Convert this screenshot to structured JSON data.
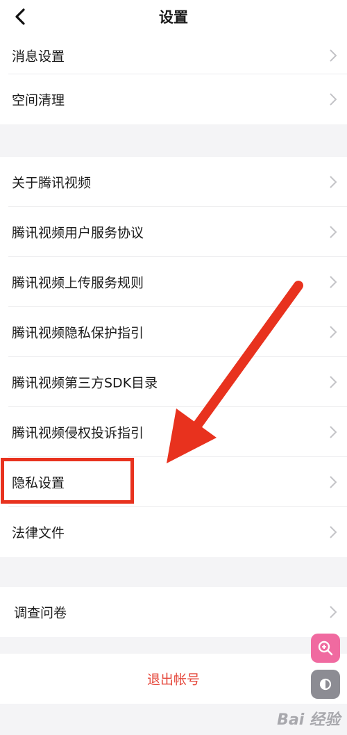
{
  "header": {
    "title": "设置"
  },
  "group1": {
    "items": [
      {
        "label": "消息设置"
      },
      {
        "label": "空间清理"
      }
    ]
  },
  "group2": {
    "items": [
      {
        "label": "关于腾讯视频"
      },
      {
        "label": "腾讯视频用户服务协议"
      },
      {
        "label": "腾讯视频上传服务规则"
      },
      {
        "label": "腾讯视频隐私保护指引"
      },
      {
        "label": "腾讯视频第三方SDK目录"
      },
      {
        "label": "腾讯视频侵权投诉指引"
      },
      {
        "label": "隐私设置"
      },
      {
        "label": "法律文件"
      }
    ]
  },
  "group3": {
    "items": [
      {
        "label": "调查问卷"
      }
    ]
  },
  "logout": {
    "label": "退出帐号"
  },
  "annotations": {
    "arrow_color": "#e8321e",
    "highlight_color": "#e8321e"
  },
  "watermark": {
    "text": "Bai 经验"
  },
  "icons": {
    "back": "chevron-left-icon",
    "chevron": "chevron-right-icon",
    "zoom": "zoom-in-icon",
    "contrast": "contrast-icon"
  }
}
